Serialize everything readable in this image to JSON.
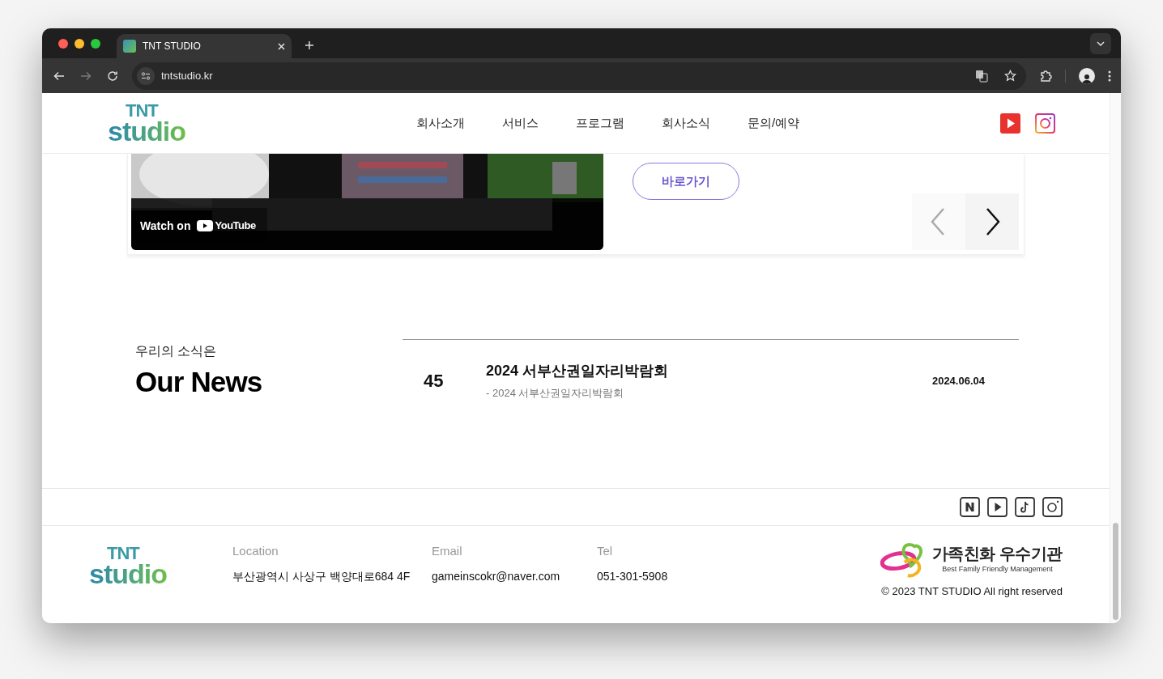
{
  "browser": {
    "tabs": [
      {
        "title": "TNT STUDIO",
        "selected": true
      }
    ],
    "nav_buttons": [
      {
        "kind": "back",
        "disabled": false
      },
      {
        "kind": "forward",
        "disabled": true
      },
      {
        "kind": "reload",
        "disabled": false
      }
    ],
    "address": "tntstudio.kr"
  },
  "header": {
    "logo": {
      "top": "TNT",
      "bottom": "studio"
    },
    "nav": [
      "회사소개",
      "서비스",
      "프로그램",
      "회사소식",
      "문의/예약"
    ],
    "social": [
      {
        "kind": "youtube"
      },
      {
        "kind": "instagram"
      }
    ]
  },
  "video": {
    "watch_on": "Watch on",
    "brand": "YouTube"
  },
  "link_button": "바로가기",
  "carousel_arrows": [
    {
      "kind": "prev",
      "disabled": true
    },
    {
      "kind": "next",
      "disabled": false
    }
  ],
  "news": {
    "eyebrow": "우리의 소식은",
    "title": "Our News",
    "items": [
      {
        "number": "45",
        "title": "2024 서부산권일자리박람회",
        "summary": "- 2024 서부산권일자리박람회",
        "date": "2024.06.04"
      }
    ]
  },
  "footer": {
    "social": [
      {
        "kind": "naver"
      },
      {
        "kind": "play"
      },
      {
        "kind": "tiktok"
      },
      {
        "kind": "instagram"
      }
    ],
    "logo": {
      "top": "TNT",
      "bottom": "studio"
    },
    "contacts": [
      {
        "label": "Location",
        "value": "부산광역시 사상구 백양대로684 4F"
      },
      {
        "label": "Email",
        "value": "gameinscokr@naver.com"
      },
      {
        "label": "Tel",
        "value": "051-301-5908"
      }
    ],
    "certification": {
      "title": "가족친화 우수기관",
      "subtitle": "Best Family Friendly Management"
    },
    "copyright": "© 2023 TNT STUDIO All right reserved"
  }
}
